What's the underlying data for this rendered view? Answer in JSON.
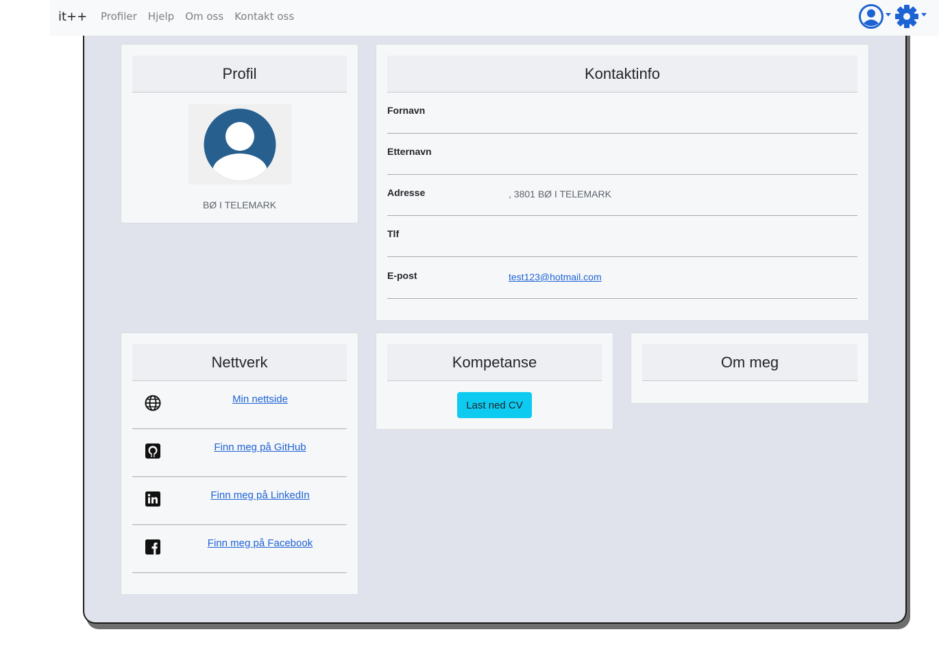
{
  "navbar": {
    "brand": "it++",
    "links": [
      "Profiler",
      "Hjelp",
      "Om oss",
      "Kontakt oss"
    ],
    "user_icon": "user-circle-icon",
    "settings_icon": "gear-icon",
    "accent": "#1e63d4"
  },
  "profil": {
    "title": "Profil",
    "avatar_icon": "avatar-placeholder-icon",
    "location": "BØ I TELEMARK"
  },
  "kontakt": {
    "title": "Kontaktinfo",
    "rows": [
      {
        "label": "Fornavn",
        "value": ""
      },
      {
        "label": "Etternavn",
        "value": ""
      },
      {
        "label": "Adresse",
        "value": ", 3801 BØ I TELEMARK"
      },
      {
        "label": "Tlf",
        "value": ""
      },
      {
        "label": "E-post",
        "value": "test123@hotmail.com"
      }
    ]
  },
  "nettverk": {
    "title": "Nettverk",
    "links": [
      {
        "icon": "globe-icon",
        "label": "Min nettside"
      },
      {
        "icon": "github-icon",
        "label": "Finn meg på GitHub"
      },
      {
        "icon": "linkedin-icon",
        "label": "Finn meg på LinkedIn"
      },
      {
        "icon": "facebook-icon",
        "label": "Finn meg på Facebook"
      }
    ]
  },
  "kompetanse": {
    "title": "Kompetanse",
    "cv_button": "Last ned CV",
    "button_color": "#0dcaf0"
  },
  "om_meg": {
    "title": "Om meg"
  }
}
